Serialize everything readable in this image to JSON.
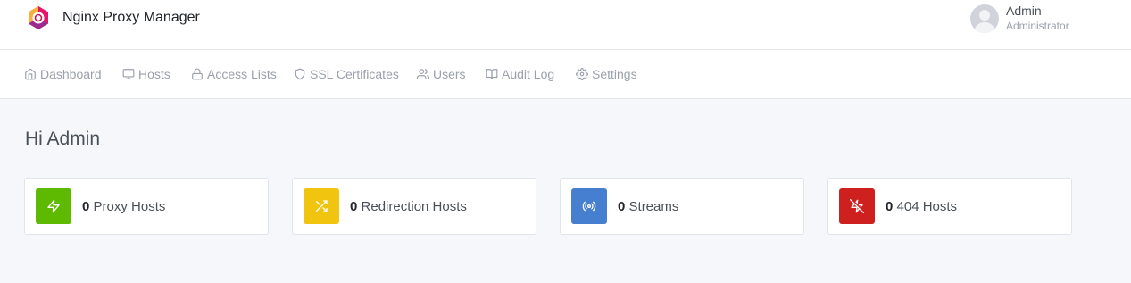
{
  "header": {
    "app_name": "Nginx Proxy Manager",
    "user": {
      "name": "Admin",
      "role": "Administrator"
    }
  },
  "nav": {
    "items": [
      {
        "label": "Dashboard",
        "icon": "home-icon"
      },
      {
        "label": "Hosts",
        "icon": "monitor-icon"
      },
      {
        "label": "Access Lists",
        "icon": "lock-icon"
      },
      {
        "label": "SSL Certificates",
        "icon": "shield-icon"
      },
      {
        "label": "Users",
        "icon": "users-icon"
      },
      {
        "label": "Audit Log",
        "icon": "book-open-icon"
      },
      {
        "label": "Settings",
        "icon": "gear-icon"
      }
    ]
  },
  "main": {
    "greeting": "Hi Admin",
    "stats": [
      {
        "count": "0",
        "label": "Proxy Hosts",
        "icon": "zap-icon",
        "color": "#5eba00"
      },
      {
        "count": "0",
        "label": "Redirection Hosts",
        "icon": "shuffle-icon",
        "color": "#f1c40f"
      },
      {
        "count": "0",
        "label": "Streams",
        "icon": "radio-icon",
        "color": "#467fcf"
      },
      {
        "count": "0",
        "label": "404 Hosts",
        "icon": "zap-off-icon",
        "color": "#cd201f"
      }
    ]
  }
}
